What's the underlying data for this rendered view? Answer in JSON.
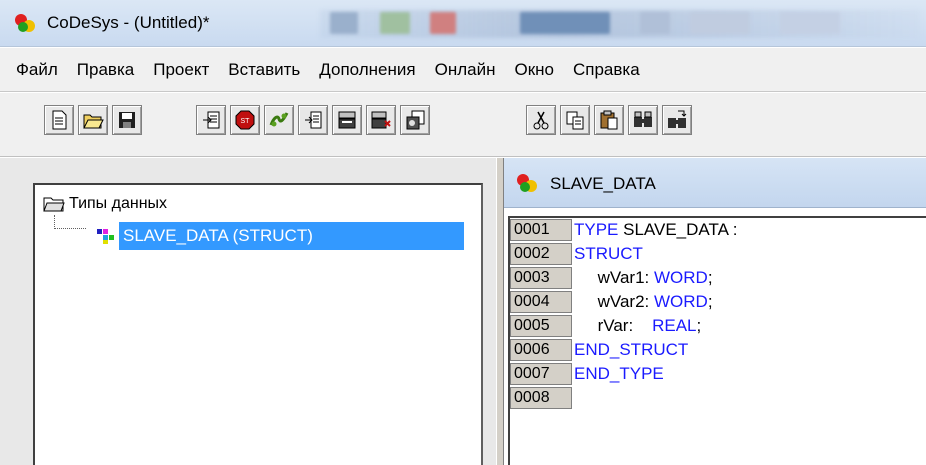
{
  "window": {
    "title": "CoDeSys - (Untitled)*",
    "app_icon": "codesys-icon"
  },
  "menu": {
    "items": [
      "Файл",
      "Правка",
      "Проект",
      "Вставить",
      "Дополнения",
      "Онлайн",
      "Окно",
      "Справка"
    ]
  },
  "toolbar": {
    "buttons": [
      "new-icon",
      "open-icon",
      "save-icon",
      "login-icon",
      "stop-icon",
      "run-icon",
      "step-icon",
      "compile-icon",
      "print-icon",
      "find-icon",
      "cut-icon",
      "copy-icon",
      "paste-icon",
      "find-replace-icon",
      "find-next-icon"
    ]
  },
  "tree": {
    "root_label": "Типы данных",
    "child_label": "SLAVE_DATA (STRUCT)"
  },
  "editor": {
    "title": "SLAVE_DATA",
    "lines": [
      {
        "no": "0001",
        "parts": [
          {
            "t": "TYPE",
            "k": true
          },
          {
            "t": " SLAVE_DATA",
            "k": false
          },
          {
            "t": " :",
            "k": false
          }
        ]
      },
      {
        "no": "0002",
        "parts": [
          {
            "t": "STRUCT",
            "k": true
          }
        ]
      },
      {
        "no": "0003",
        "parts": [
          {
            "t": "     wVar1: ",
            "k": false
          },
          {
            "t": "WORD",
            "k": true
          },
          {
            "t": ";",
            "k": false
          }
        ]
      },
      {
        "no": "0004",
        "parts": [
          {
            "t": "     wVar2: ",
            "k": false
          },
          {
            "t": "WORD",
            "k": true
          },
          {
            "t": ";",
            "k": false
          }
        ]
      },
      {
        "no": "0005",
        "parts": [
          {
            "t": "     rVar:    ",
            "k": false
          },
          {
            "t": "REAL",
            "k": true
          },
          {
            "t": ";",
            "k": false
          }
        ]
      },
      {
        "no": "0006",
        "parts": [
          {
            "t": "END_STRUCT",
            "k": true
          }
        ]
      },
      {
        "no": "0007",
        "parts": [
          {
            "t": "END_TYPE",
            "k": true
          }
        ]
      },
      {
        "no": "0008",
        "parts": []
      }
    ]
  },
  "colors": {
    "keyword": "#1a1aff",
    "selection": "#3399ff"
  }
}
